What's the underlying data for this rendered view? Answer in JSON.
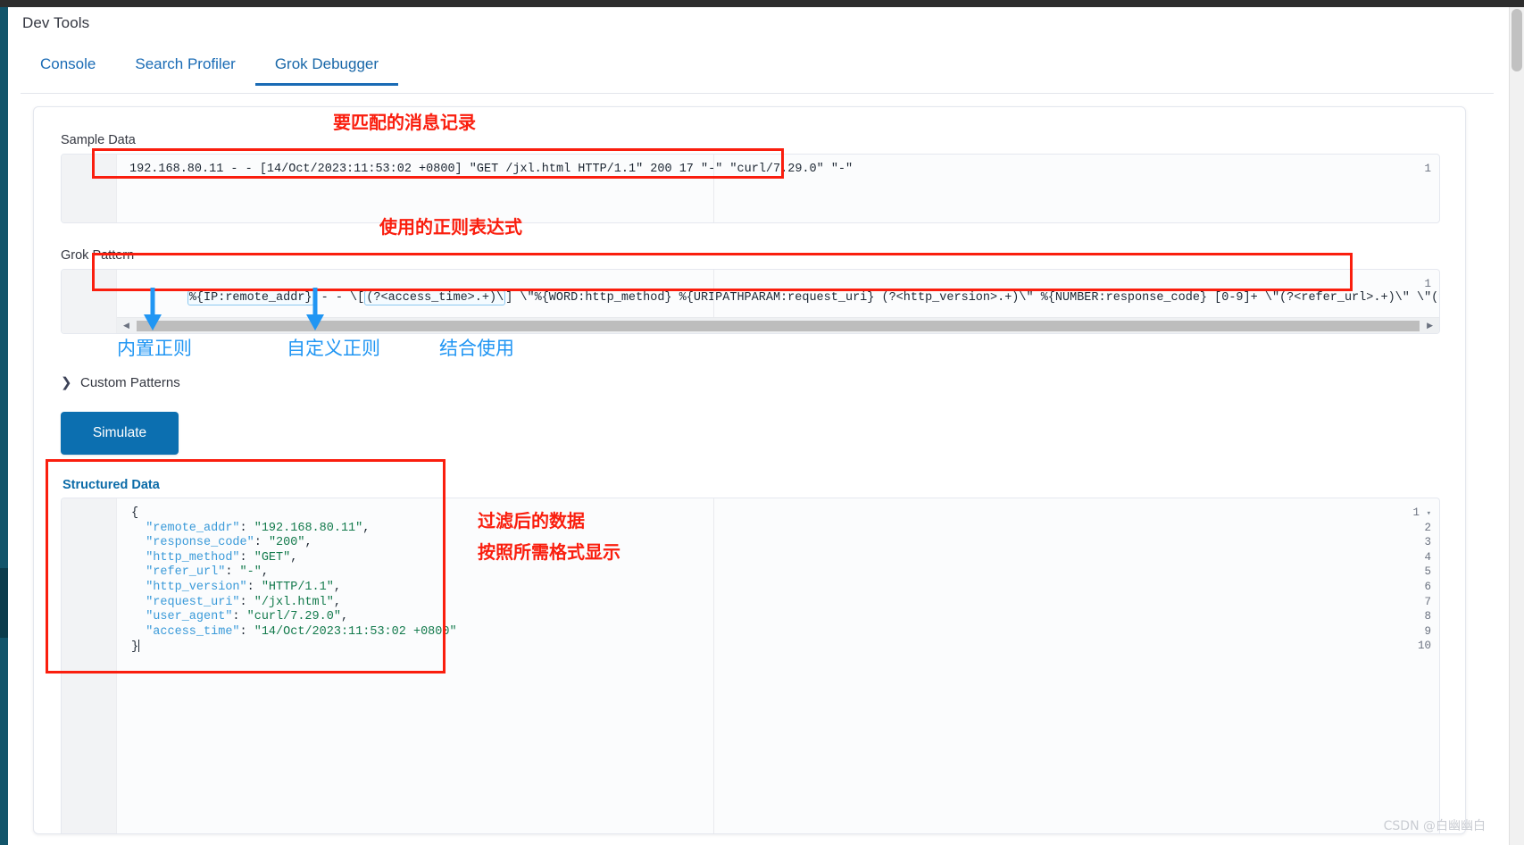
{
  "window": {
    "app_title": "Dev Tools"
  },
  "tabs": [
    {
      "label": "Console",
      "active": false
    },
    {
      "label": "Search Profiler",
      "active": false
    },
    {
      "label": "Grok Debugger",
      "active": true
    }
  ],
  "sample_data": {
    "label": "Sample Data",
    "line_number": "1",
    "value": "192.168.80.11 - - [14/Oct/2023:11:53:02 +0800] \"GET /jxl.html HTTP/1.1\" 200 17 \"-\" \"curl/7.29.0\" \"-\""
  },
  "grok_pattern": {
    "label": "Grok Pattern",
    "line_number": "1",
    "tokens": [
      {
        "text": "%{IP:remote_addr}",
        "pill": true
      },
      {
        "text": " - - \\[",
        "pill": false
      },
      {
        "text": "(?<access_time>.+)\\",
        "pill": true
      },
      {
        "text": "] \\\"%{WORD:http_method} %{URIPATHPARAM:request_uri} (?<http_version>.+)\\\" %{NUMBER:response_code} [0-9]+ \\\"(?<refer_url>.+)\\\" \\\"(?<user_agen",
        "pill": false
      }
    ],
    "full_value": "%{IP:remote_addr} - - \\[(?<access_time>.+)\\] \\\"%{WORD:http_method} %{URIPATHPARAM:request_uri} (?<http_version>.+)\\\" %{NUMBER:response_code} [0-9]+ \\\"(?<refer_url>.+)\\\" \\\"(?<user_agent>.+)\\\""
  },
  "custom_patterns": {
    "label": "Custom Patterns",
    "chevron": "chevron-right-icon",
    "expanded": false
  },
  "simulate_button": {
    "label": "Simulate"
  },
  "structured_data": {
    "label": "Structured Data",
    "lines": [
      {
        "num": "1",
        "fold": true,
        "parts": [
          {
            "t": "{",
            "c": "punct"
          }
        ]
      },
      {
        "num": "2",
        "fold": false,
        "parts": [
          {
            "t": "  \"remote_addr\"",
            "c": "key"
          },
          {
            "t": ": ",
            "c": "punct"
          },
          {
            "t": "\"192.168.80.11\"",
            "c": "str"
          },
          {
            "t": ",",
            "c": "punct"
          }
        ]
      },
      {
        "num": "3",
        "fold": false,
        "parts": [
          {
            "t": "  \"response_code\"",
            "c": "key"
          },
          {
            "t": ": ",
            "c": "punct"
          },
          {
            "t": "\"200\"",
            "c": "str"
          },
          {
            "t": ",",
            "c": "punct"
          }
        ]
      },
      {
        "num": "4",
        "fold": false,
        "parts": [
          {
            "t": "  \"http_method\"",
            "c": "key"
          },
          {
            "t": ": ",
            "c": "punct"
          },
          {
            "t": "\"GET\"",
            "c": "str"
          },
          {
            "t": ",",
            "c": "punct"
          }
        ]
      },
      {
        "num": "5",
        "fold": false,
        "parts": [
          {
            "t": "  \"refer_url\"",
            "c": "key"
          },
          {
            "t": ": ",
            "c": "punct"
          },
          {
            "t": "\"-\"",
            "c": "str"
          },
          {
            "t": ",",
            "c": "punct"
          }
        ]
      },
      {
        "num": "6",
        "fold": false,
        "parts": [
          {
            "t": "  \"http_version\"",
            "c": "key"
          },
          {
            "t": ": ",
            "c": "punct"
          },
          {
            "t": "\"HTTP/1.1\"",
            "c": "str"
          },
          {
            "t": ",",
            "c": "punct"
          }
        ]
      },
      {
        "num": "7",
        "fold": false,
        "parts": [
          {
            "t": "  \"request_uri\"",
            "c": "key"
          },
          {
            "t": ": ",
            "c": "punct"
          },
          {
            "t": "\"/jxl.html\"",
            "c": "str"
          },
          {
            "t": ",",
            "c": "punct"
          }
        ]
      },
      {
        "num": "8",
        "fold": false,
        "parts": [
          {
            "t": "  \"user_agent\"",
            "c": "key"
          },
          {
            "t": ": ",
            "c": "punct"
          },
          {
            "t": "\"curl/7.29.0\"",
            "c": "str"
          },
          {
            "t": ",",
            "c": "punct"
          }
        ]
      },
      {
        "num": "9",
        "fold": false,
        "parts": [
          {
            "t": "  \"access_time\"",
            "c": "key"
          },
          {
            "t": ": ",
            "c": "punct"
          },
          {
            "t": "\"14/Oct/2023:11:53:02 +0800\"",
            "c": "str"
          }
        ]
      },
      {
        "num": "10",
        "fold": false,
        "parts": [
          {
            "t": "}",
            "c": "punct"
          }
        ]
      }
    ]
  },
  "annotations": {
    "red_color": "#fa1e0e",
    "blue_color": "#2196f3",
    "sample_data_note": "要匹配的消息记录",
    "grok_pattern_note": "使用的正则表达式",
    "builtin_regex_note": "内置正则",
    "custom_regex_note": "自定义正则",
    "combined_note": "结合使用",
    "output_note_line1": "过滤后的数据",
    "output_note_line2": "按照所需格式显示"
  },
  "watermark": "CSDN @白幽幽白"
}
